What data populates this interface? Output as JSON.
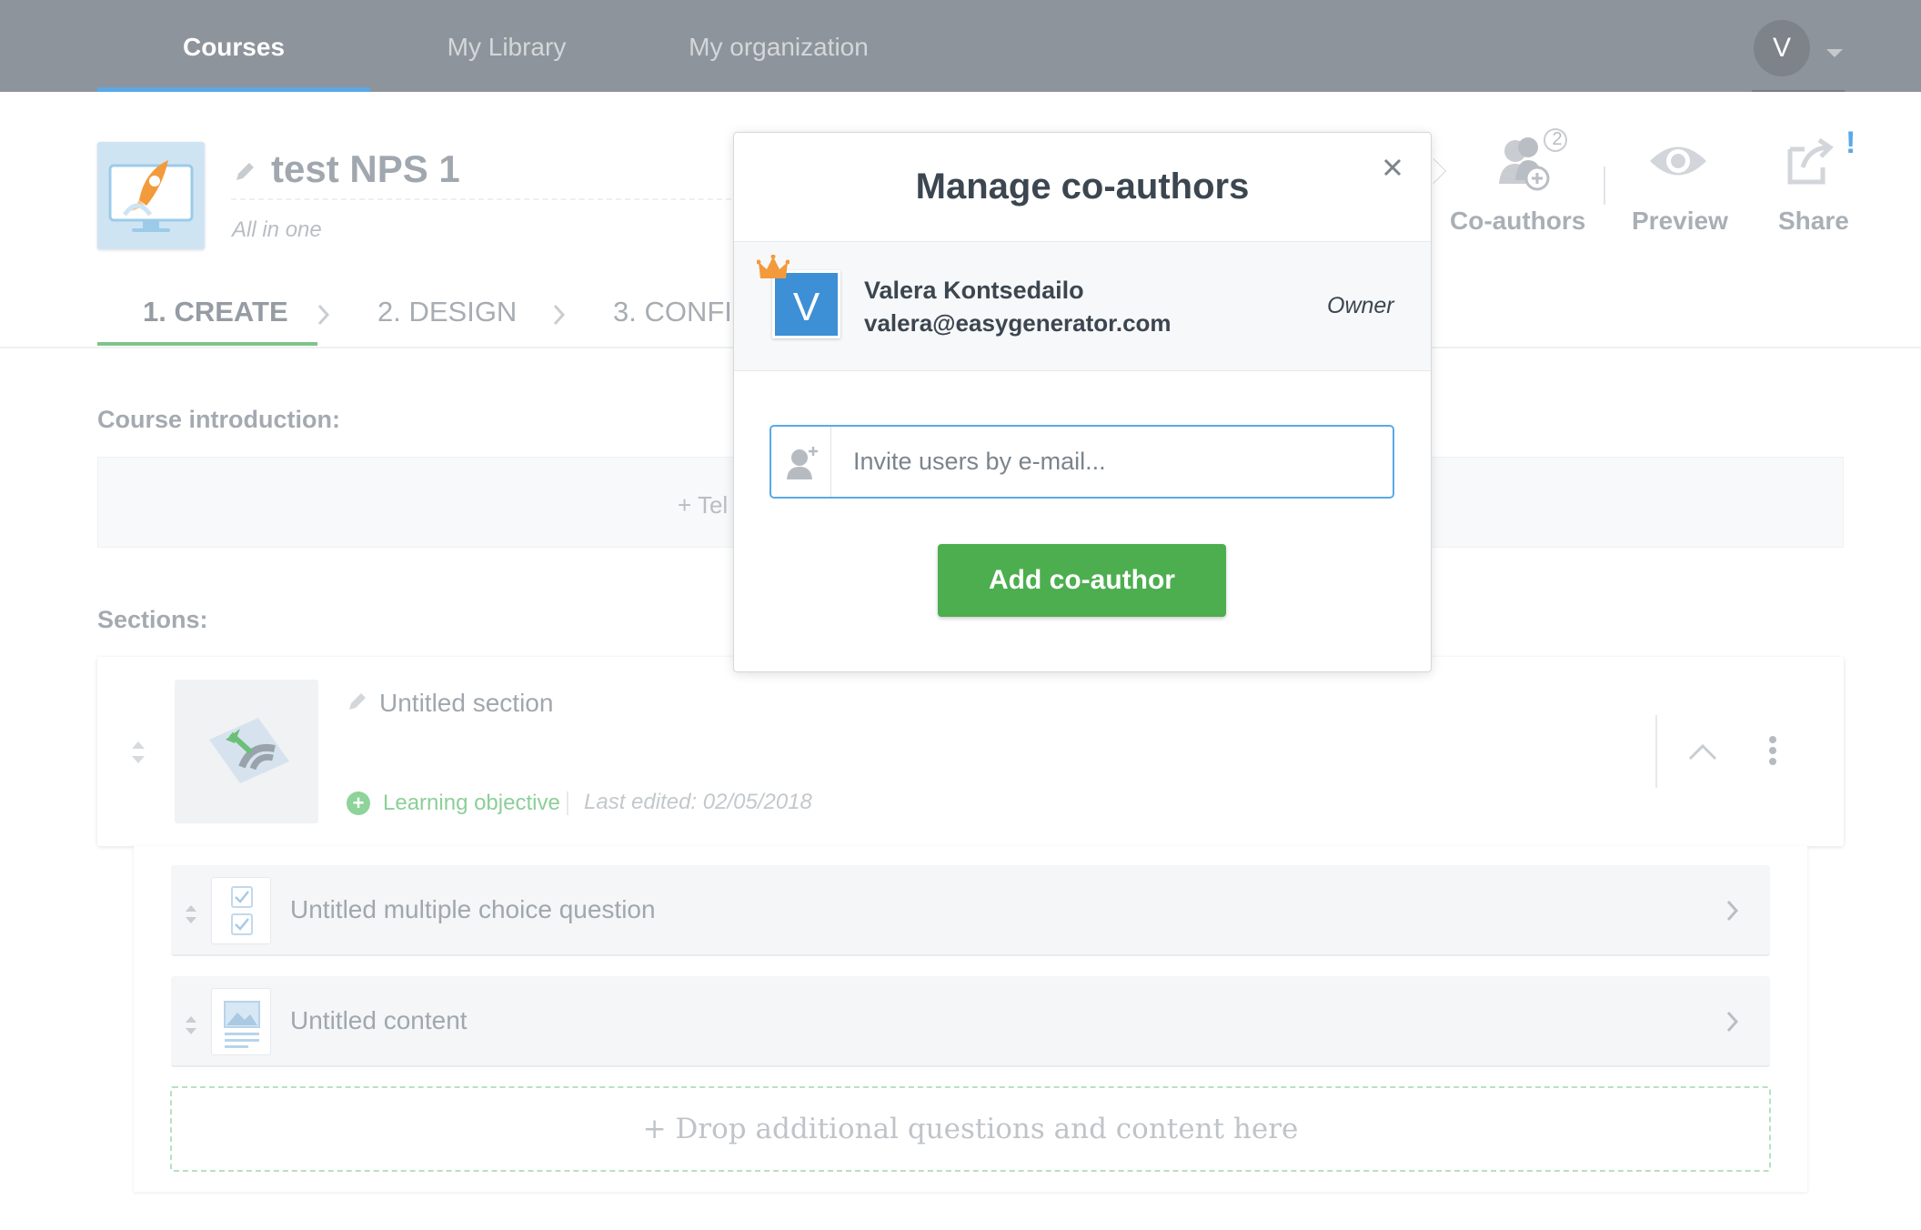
{
  "nav": {
    "tabs": [
      {
        "label": "Courses",
        "active": true
      },
      {
        "label": "My Library",
        "active": false
      },
      {
        "label": "My organization",
        "active": false
      }
    ],
    "user_initial": "V"
  },
  "course": {
    "title": "test NPS 1",
    "subtitle": "All in one"
  },
  "steps": [
    {
      "label": "1. CREATE",
      "active": true
    },
    {
      "label": "2. DESIGN",
      "active": false
    },
    {
      "label": "3. CONFIG",
      "active": false
    }
  ],
  "toolbar": {
    "coauthors_label": "Co-authors",
    "coauthors_count": "2",
    "preview_label": "Preview",
    "share_label": "Share",
    "share_alert": "!"
  },
  "content": {
    "intro_heading": "Course introduction:",
    "intro_placeholder": "+ Tel",
    "sections_heading": "Sections:",
    "section": {
      "title": "Untitled section",
      "learning_objective": "Learning objective",
      "last_edited": "Last edited: 02/05/2018"
    },
    "items": [
      {
        "title": "Untitled multiple choice question",
        "icon": "checkbox-question-icon"
      },
      {
        "title": "Untitled content",
        "icon": "content-image-icon"
      }
    ],
    "drop_zone": "+ Drop additional questions and content here"
  },
  "modal": {
    "title": "Manage co-authors",
    "owner": {
      "initial": "V",
      "name": "Valera Kontsedailo",
      "email": "valera@easygenerator.com",
      "role": "Owner"
    },
    "invite_placeholder": "Invite users by e-mail...",
    "invite_value": "",
    "add_button": "Add co-author"
  },
  "colors": {
    "nav_bg": "#8e949b",
    "accent_blue": "#5aa9e6",
    "accent_green": "#4cae4f",
    "owner_avatar": "#3d8fd6"
  }
}
